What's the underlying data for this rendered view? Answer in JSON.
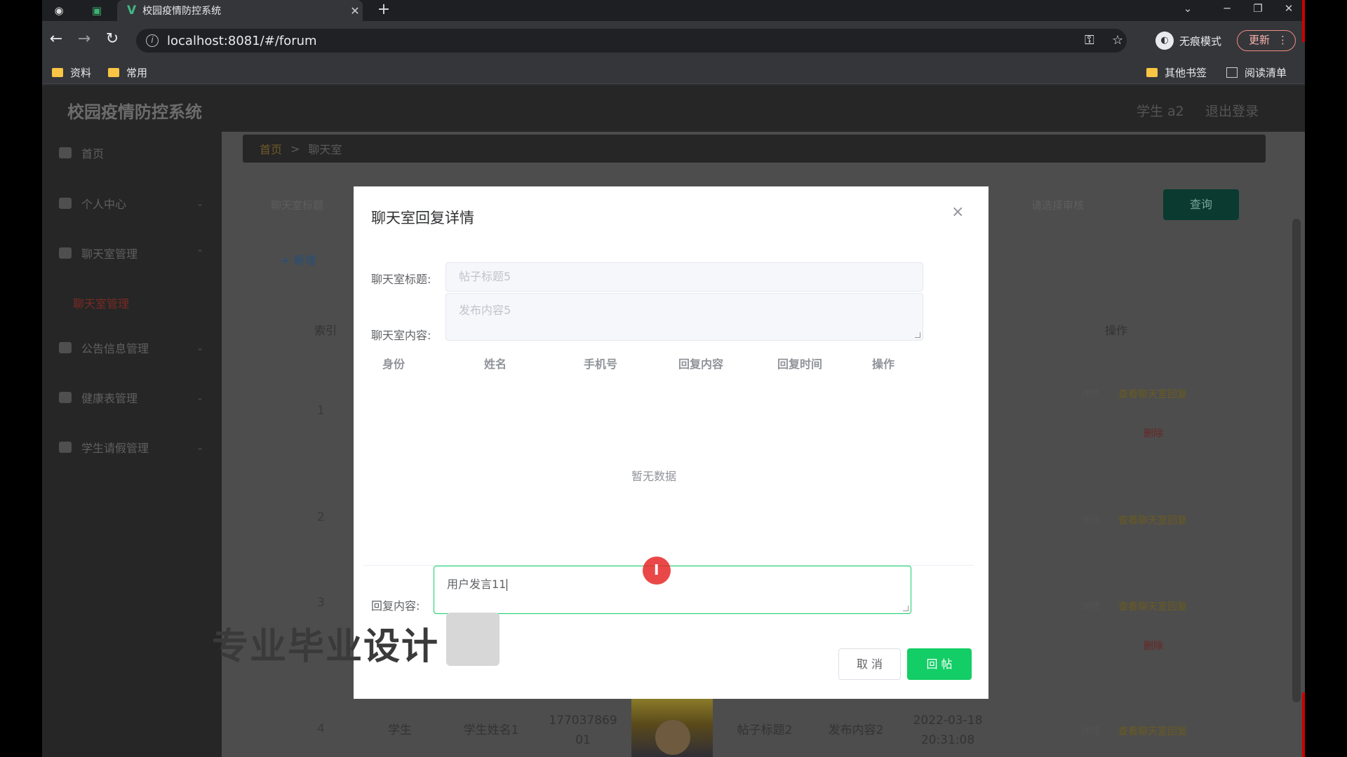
{
  "browser": {
    "tab_title": "校园疫情防控系统",
    "tab_close": "✕",
    "new_tab": "+",
    "back": "←",
    "forward": "→",
    "reload": "↻",
    "url": "localhost:8081/#/forum",
    "key_icon": "⚿",
    "star_icon": "☆",
    "incognito_label": "无痕模式",
    "update_label": "更新",
    "update_menu": "⋮",
    "win_controls": [
      "⌄",
      "─",
      "❐",
      "✕"
    ],
    "bookmarks": [
      "资料",
      "常用"
    ],
    "bookmarks_right": [
      "其他书签",
      "阅读清单"
    ]
  },
  "app": {
    "title": "校园疫情防控系统",
    "user": "学生 a2",
    "logout": "退出登录",
    "sidebar": [
      {
        "label": "首页",
        "arrow": ""
      },
      {
        "label": "个人中心",
        "arrow": "⌄"
      },
      {
        "label": "聊天室管理",
        "arrow": "⌃"
      },
      {
        "label": "公告信息管理",
        "arrow": "⌄"
      },
      {
        "label": "健康表管理",
        "arrow": "⌄"
      },
      {
        "label": "学生请假管理",
        "arrow": "⌄"
      }
    ],
    "sidebar_sub": "聊天室管理",
    "breadcrumb": {
      "home": "首页",
      "sep": ">",
      "current": "聊天室"
    },
    "search_placeholders": [
      "聊天室标题",
      "请选择审核"
    ],
    "query_button": "查询",
    "add_button": "+ 新增",
    "col_index": "索引",
    "col_op": "操作",
    "rows": [
      {
        "index": "1",
        "has_delete": true
      },
      {
        "index": "2",
        "has_delete": false
      },
      {
        "index": "3",
        "has_delete": true
      },
      {
        "index": "4",
        "has_delete": false
      }
    ],
    "op_detail": "详情",
    "op_edit": "查看聊天室回复",
    "op_delete": "删除",
    "row4": {
      "role": "学生",
      "name": "学生姓名1",
      "phone_line1": "177037869",
      "phone_line2": "01",
      "title": "帖子标题2",
      "content": "发布内容2",
      "date": "2022-03-18",
      "time": "20:31:08"
    }
  },
  "modal": {
    "title": "聊天室回复详情",
    "close": "×",
    "label_title": "聊天室标题:",
    "value_title": "帖子标题5",
    "label_content": "聊天室内容:",
    "value_content": "发布内容5",
    "columns": [
      "身份",
      "姓名",
      "手机号",
      "回复内容",
      "回复时间",
      "操作"
    ],
    "empty_text": "暂无数据",
    "label_reply": "回复内容:",
    "reply_value": "用户发言11",
    "cancel": "取 消",
    "submit": "回 帖"
  },
  "watermark": "专业毕业设计"
}
